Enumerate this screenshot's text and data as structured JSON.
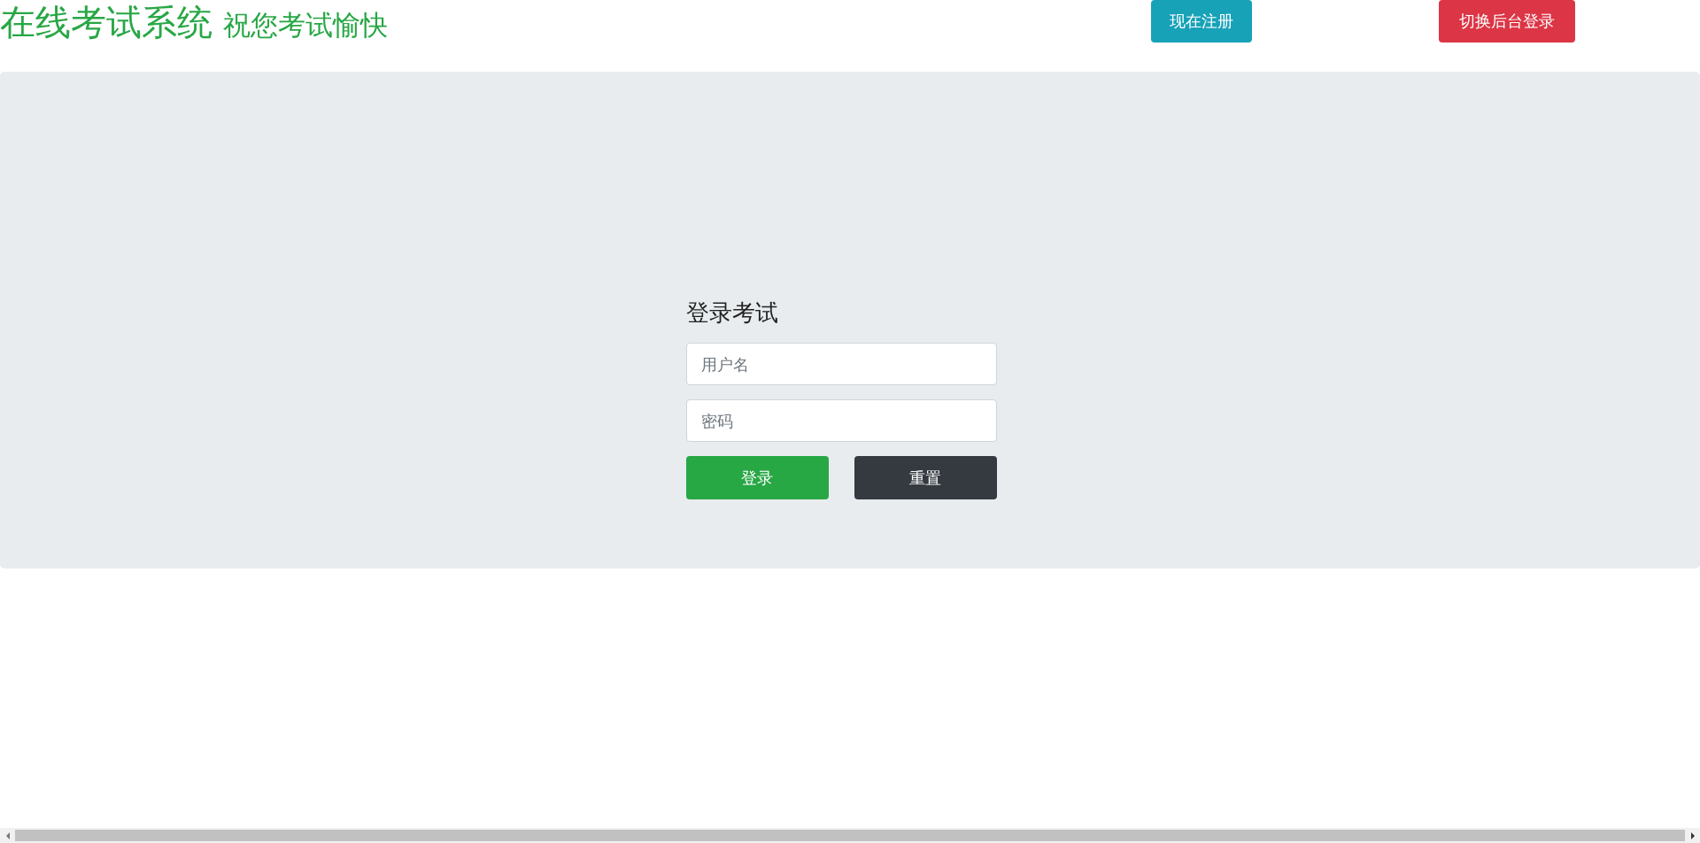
{
  "header": {
    "title": "在线考试系统",
    "subtitle": "祝您考试愉快",
    "buttons": [
      {
        "label": "现在注册",
        "kind": "info"
      },
      {
        "label": "切换后台登录",
        "kind": "danger"
      }
    ]
  },
  "login": {
    "title": "登录考试",
    "fields": [
      {
        "placeholder": "用户名"
      },
      {
        "placeholder": "密码"
      }
    ],
    "buttons": [
      {
        "label": "登录",
        "kind": "success"
      },
      {
        "label": "重置",
        "kind": "dark"
      }
    ]
  }
}
